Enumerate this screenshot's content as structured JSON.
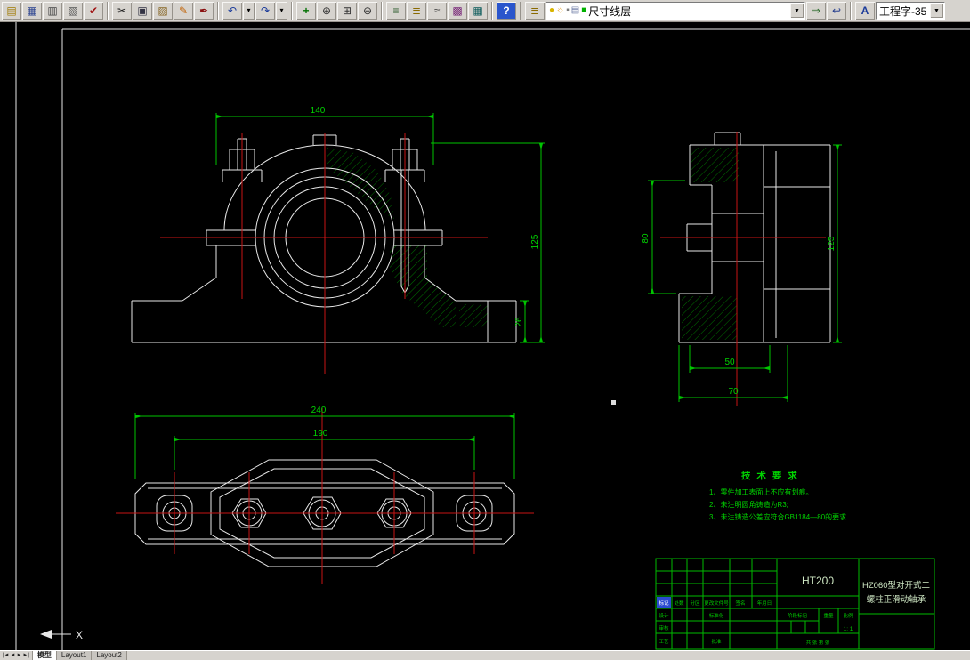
{
  "toolbar": {
    "layer_combo": "尺寸线层",
    "style_combo": "工程字-35",
    "icons": {
      "open": "▤",
      "save": "▦",
      "plot": "▥",
      "preview": "▧",
      "spell": "✔",
      "cut": "✂",
      "copy": "▣",
      "paste": "▨",
      "pencil": "✎",
      "brush": "✒",
      "undo": "↶",
      "redo": "↷",
      "dropdown": "▾",
      "pan": "+",
      "zoom_realtime": "⊕",
      "zoom_window": "⊞",
      "zoom_previous": "⊖",
      "properties": "≡",
      "layers": "≣",
      "linetype": "≈",
      "design_center": "▩",
      "table": "▦",
      "help": "?",
      "layer_manager": "≣",
      "set_layer_current": "⇒",
      "layer_previous": "↩",
      "text_style": "A",
      "bulb": "●",
      "sun": "☼",
      "lock": "▪",
      "layer_plot": "▤",
      "color_swatch": "■",
      "combo_arrow": "▼",
      "nav_first": "|◄",
      "nav_prev": "◄",
      "nav_next": "►",
      "nav_last": "►|"
    }
  },
  "drawing": {
    "dims": {
      "front_width": "140",
      "front_height": "125",
      "front_base": "26",
      "side_height": "80",
      "side_total": "125",
      "side_depth": "50",
      "side_base": "70",
      "plan_length": "240",
      "plan_bolt_span": "190"
    },
    "tech": {
      "title": "技 术 要 求",
      "item1": "1、零件加工表面上不应有划痕。",
      "item2": "2、未注明圆角铸造为R3;",
      "item3": "3、未注铸造公差应符合GB1184—80的要求."
    },
    "tb": {
      "material": "HT200",
      "name1": "HZ060型对开式二",
      "name2": "螺柱正滑动轴承",
      "biaoji": "标记",
      "chushu": "处数",
      "fenqu": "分区",
      "wenjian": "更改文件号",
      "qianming": "签名",
      "riqi": "年月日",
      "sheji": "设计",
      "shenhe": "审核",
      "gongyi": "工艺",
      "biaozhun": "标准化",
      "pizhun": "批准",
      "jieduan": "阶段标记",
      "zhongliang": "重量",
      "bili": "比例",
      "bili_val": "1: 1",
      "zhangshu": "共  张  第  张"
    },
    "ucs_x": "X"
  },
  "statusbar": {
    "tab_model": "模型",
    "tab_layout1": "Layout1",
    "tab_layout2": "Layout2"
  }
}
